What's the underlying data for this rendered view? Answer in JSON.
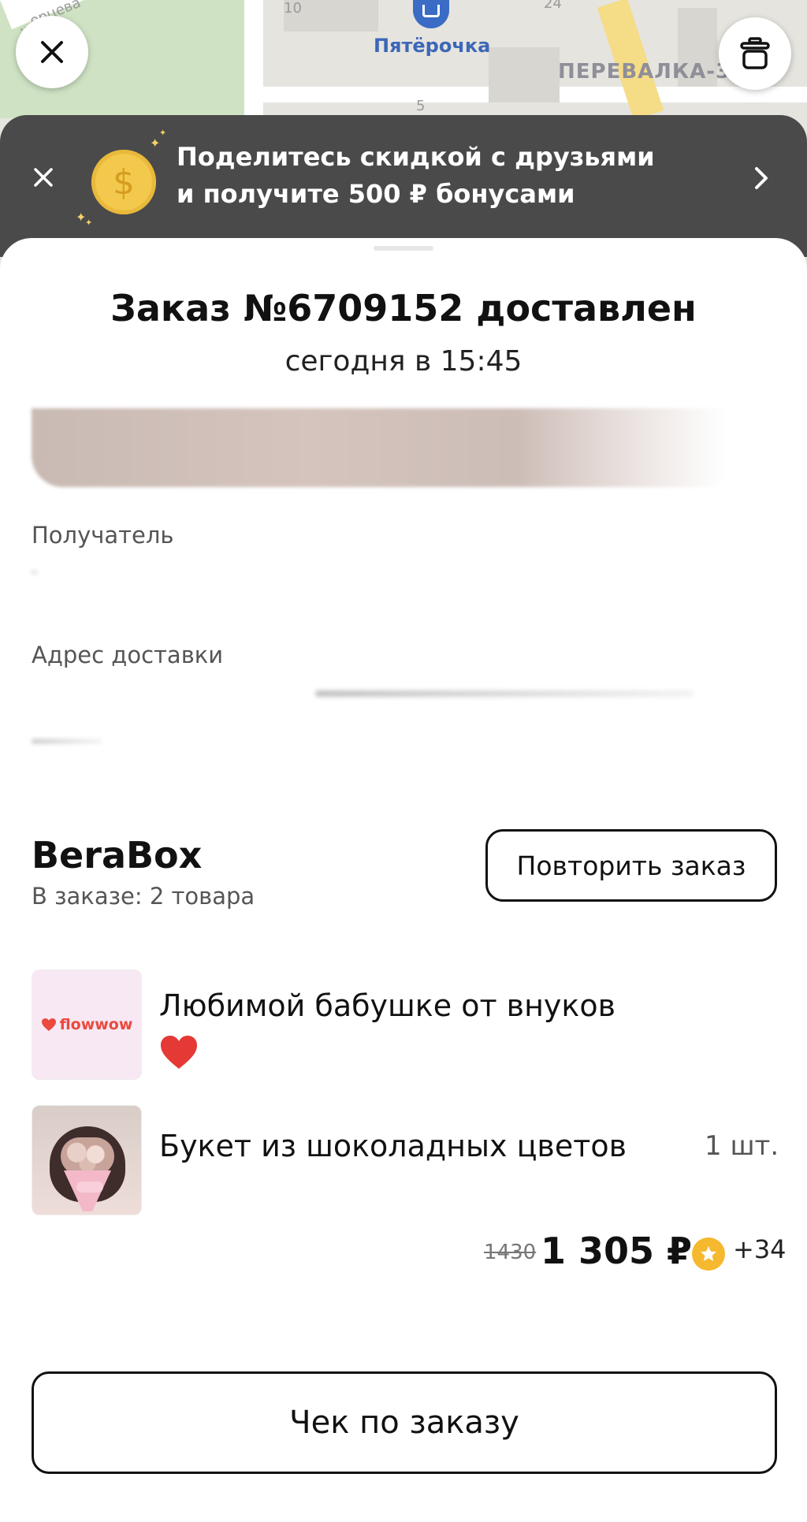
{
  "map": {
    "store_label": "Пятёрочка",
    "district_label": "ПЕРЕВАЛКА-3",
    "street_label": "...ерцева",
    "house_numbers": [
      "10",
      "24",
      "5"
    ]
  },
  "promo": {
    "text_line1": "Поделитесь скидкой с друзьями",
    "text_line2": "и получите 500 ₽ бонусами",
    "coin_symbol": "$"
  },
  "order": {
    "title": "Заказ №6709152 доставлен",
    "time": "сегодня в 15:45"
  },
  "recipient": {
    "label": "Получатель"
  },
  "address": {
    "label": "Адрес доставки"
  },
  "shop": {
    "name": "BeraBox",
    "count": "В заказе: 2 товара",
    "repeat_label": "Повторить заказ"
  },
  "items": [
    {
      "name": "Любимой бабушке от внуков",
      "logo_text": "flowwow"
    },
    {
      "name": "Букет из шоколадных цветов",
      "qty": "1 шт."
    }
  ],
  "price": {
    "old": "1430",
    "new": "1 305 ₽",
    "bonus": "+34"
  },
  "receipt_label": "Чек по заказу",
  "colors": {
    "promo_bg": "#4a4a4a",
    "coin": "#f2c94c",
    "heart": "#e53935",
    "bonus_star": "#f5b82e"
  }
}
